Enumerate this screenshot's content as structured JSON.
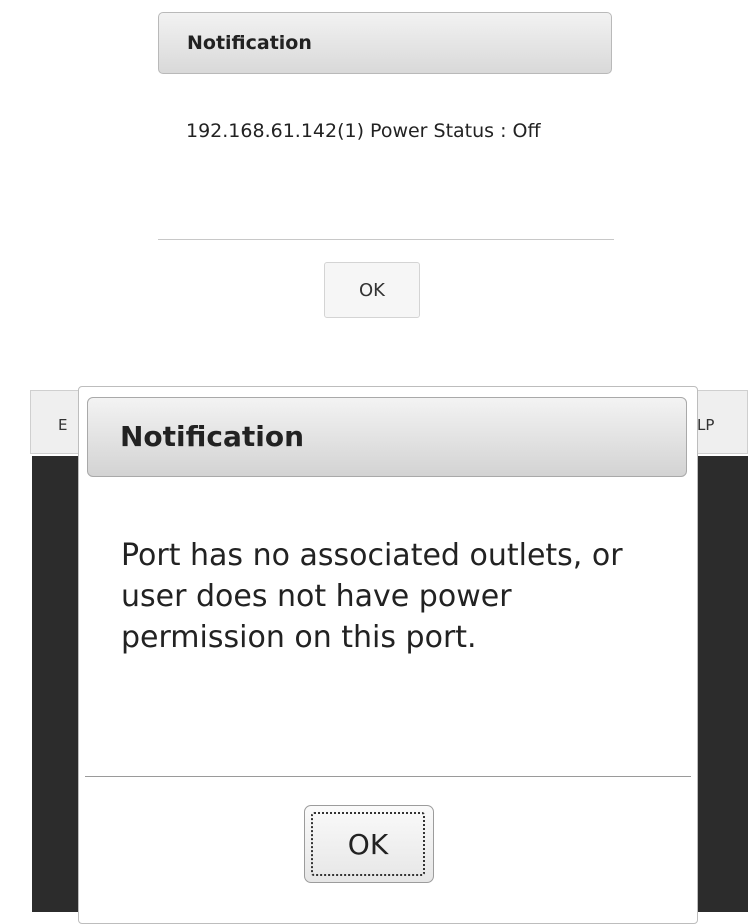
{
  "top_dialog": {
    "title": "Notification",
    "message": "192.168.61.142(1) Power Status : Off",
    "ok_label": "OK"
  },
  "background": {
    "left_header_text": "E",
    "right_header_text": "LP"
  },
  "bottom_dialog": {
    "title": "Notification",
    "message": "Port has no associated outlets, or user does not have power permission on this port.",
    "ok_label": "OK"
  }
}
